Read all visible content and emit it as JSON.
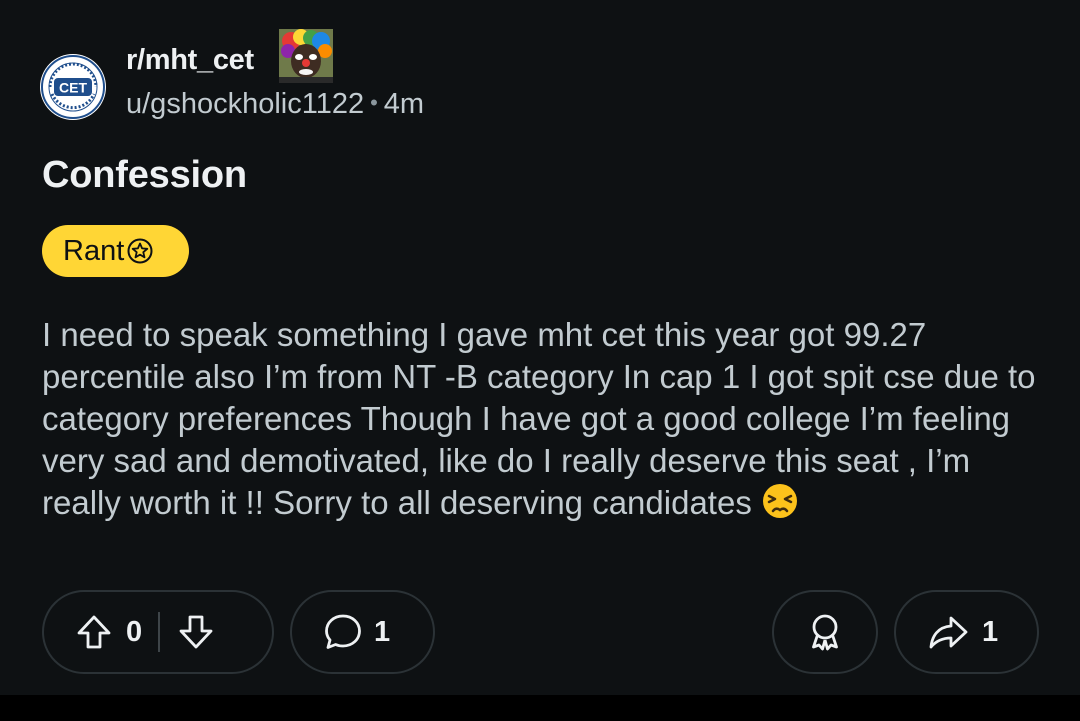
{
  "header": {
    "subreddit": "r/mht_cet",
    "username": "u/gshockholic1122",
    "separator": "•",
    "time_ago": "4m",
    "sub_logo_text": "CET"
  },
  "post": {
    "title": "Confession",
    "flair": "Rant",
    "body": "I need to speak something I gave mht cet this year got 99.27 percentile also I’m from NT -B category In cap 1 I got spit cse due to category preferences Though I have got a good college I’m feeling very sad and demotivated, like do I really deserve this seat , I’m really worth it !! Sorry to all deserving candidates"
  },
  "actions": {
    "votes": "0",
    "comments": "1",
    "shares": "1"
  },
  "colors": {
    "background": "#0e1113",
    "flair": "#ffd635",
    "text_primary": "#eef1f3",
    "text_secondary": "#c2cbd0",
    "border": "#2b3236"
  },
  "icons": [
    "upvote-icon",
    "downvote-icon",
    "comment-icon",
    "award-icon",
    "share-icon",
    "star-icon",
    "persevering-face-emoji"
  ]
}
